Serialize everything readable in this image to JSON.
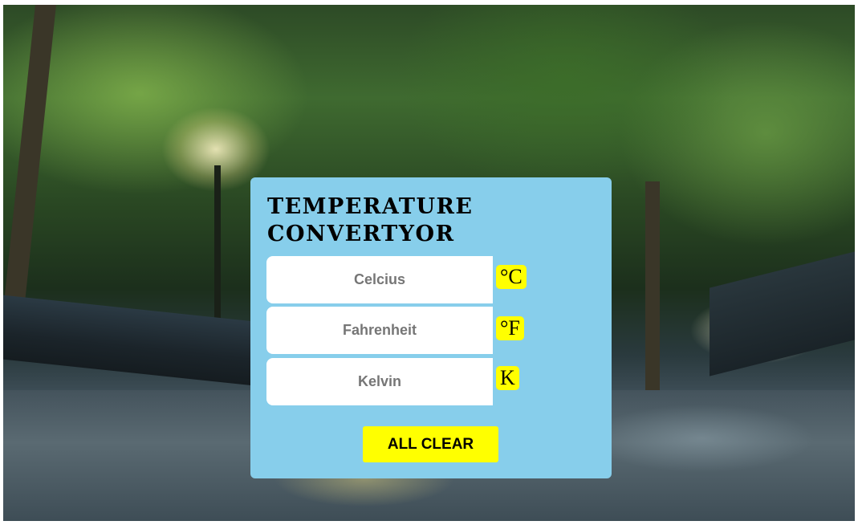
{
  "converter": {
    "title": "TEMPERATURE CONVERTYOR",
    "fields": [
      {
        "placeholder": "Celcius",
        "value": "",
        "unit": "°C"
      },
      {
        "placeholder": "Fahrenheit",
        "value": "",
        "unit": "°F"
      },
      {
        "placeholder": "Kelvin",
        "value": "",
        "unit": "K"
      }
    ],
    "clear_label": "ALL CLEAR"
  },
  "colors": {
    "card_background": "#87ceeb",
    "unit_badge": "#ffff00",
    "button": "#ffff00",
    "field_background": "#ffffff",
    "placeholder_text": "#767676"
  }
}
